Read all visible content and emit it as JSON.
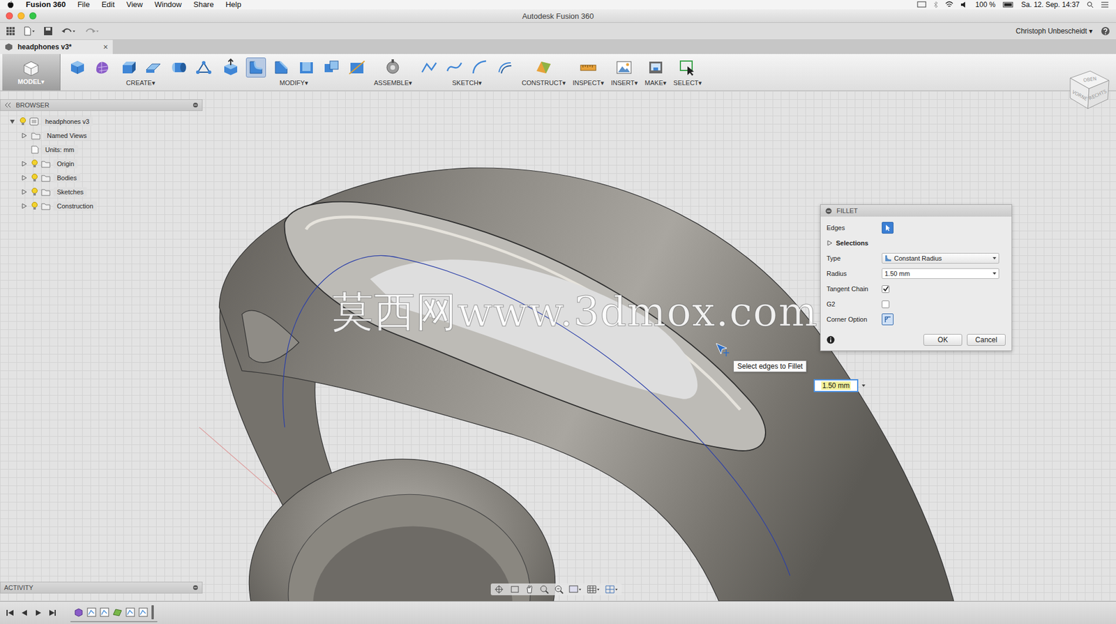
{
  "menubar": {
    "items": [
      {
        "label": "Fusion 360",
        "bold": true
      },
      {
        "label": "File",
        "bold": false
      },
      {
        "label": "Edit",
        "bold": false
      },
      {
        "label": "View",
        "bold": false
      },
      {
        "label": "Window",
        "bold": false
      },
      {
        "label": "Share",
        "bold": false
      },
      {
        "label": "Help",
        "bold": false
      }
    ],
    "battery": "100 %",
    "clock": "Sa. 12. Sep. 14:37"
  },
  "window": {
    "title": "Autodesk Fusion 360"
  },
  "user": {
    "name": "Christoph Unbescheidt",
    "caret": "▾"
  },
  "tabs": [
    {
      "label": "headphones v3*",
      "selected": true,
      "close": "×"
    }
  ],
  "toolbar": {
    "workspace": {
      "label": "MODEL",
      "caret": "▾"
    },
    "groups": [
      {
        "label": "CREATE",
        "caret": "▾",
        "tools": [
          {
            "selected": false
          },
          {
            "selected": false
          },
          {
            "selected": false
          },
          {
            "selected": false
          },
          {
            "selected": false
          },
          {
            "selected": false
          }
        ]
      },
      {
        "label": "MODIFY",
        "caret": "▾",
        "tools": [
          {
            "selected": false
          },
          {
            "selected": true
          },
          {
            "selected": false
          },
          {
            "selected": false
          },
          {
            "selected": false
          },
          {
            "selected": false
          }
        ]
      },
      {
        "label": "ASSEMBLE",
        "caret": "▾",
        "tools": [
          {
            "selected": false
          }
        ]
      },
      {
        "label": "SKETCH",
        "caret": "▾",
        "tools": [
          {
            "selected": false
          },
          {
            "selected": false
          },
          {
            "selected": false
          },
          {
            "selected": false
          }
        ]
      },
      {
        "label": "CONSTRUCT",
        "caret": "▾",
        "tools": [
          {
            "selected": false
          }
        ]
      },
      {
        "label": "INSPECT",
        "caret": "▾",
        "tools": [
          {
            "selected": false
          }
        ]
      },
      {
        "label": "INSERT",
        "caret": "▾",
        "tools": [
          {
            "selected": false
          }
        ]
      },
      {
        "label": "MAKE",
        "caret": "▾",
        "tools": [
          {
            "selected": false
          }
        ]
      },
      {
        "label": "SELECT",
        "caret": "▾",
        "tools": [
          {
            "selected": false
          }
        ]
      }
    ]
  },
  "browser": {
    "title": "BROWSER",
    "root": {
      "label": "headphones v3",
      "expanded": true,
      "visible": true,
      "children": [
        {
          "label": "Named Views",
          "kind": "folder",
          "expanded": false,
          "visible": false
        },
        {
          "label": "Units: mm",
          "kind": "setting",
          "expanded": false,
          "visible": false
        },
        {
          "label": "Origin",
          "kind": "folder",
          "expanded": false,
          "visible": true
        },
        {
          "label": "Bodies",
          "kind": "folder",
          "expanded": false,
          "visible": true
        },
        {
          "label": "Sketches",
          "kind": "folder",
          "expanded": false,
          "visible": true
        },
        {
          "label": "Construction",
          "kind": "folder",
          "expanded": false,
          "visible": true
        }
      ]
    }
  },
  "viewport": {
    "watermark": "莫西网www.3dmox.com",
    "view_cube": [
      "OBEN",
      "VORNE",
      "RECHTS"
    ]
  },
  "fillet": {
    "title": "FILLET",
    "rows": [
      {
        "kind": "select",
        "label": "Edges",
        "selected": true
      },
      {
        "kind": "section",
        "label": "Selections",
        "expanded": false
      },
      {
        "kind": "dropdown",
        "label": "Type",
        "value": "Constant Radius"
      },
      {
        "kind": "input",
        "label": "Radius",
        "value": "1.50 mm"
      },
      {
        "kind": "checkbox",
        "label": "Tangent Chain",
        "checked": true
      },
      {
        "kind": "checkbox",
        "label": "G2",
        "checked": false
      },
      {
        "kind": "option",
        "label": "Corner Option"
      }
    ],
    "buttons": [
      "OK",
      "Cancel"
    ]
  },
  "tooltip": {
    "text": "Select edges to Fillet"
  },
  "radius_input": {
    "value": "1.50 mm"
  },
  "activity": {
    "title": "ACTIVITY"
  },
  "timeline": {
    "features": [
      {
        "kind": "body"
      },
      {
        "kind": "sketch"
      },
      {
        "kind": "sketch"
      },
      {
        "kind": "plane"
      },
      {
        "kind": "sketch"
      },
      {
        "kind": "sketch"
      }
    ]
  }
}
